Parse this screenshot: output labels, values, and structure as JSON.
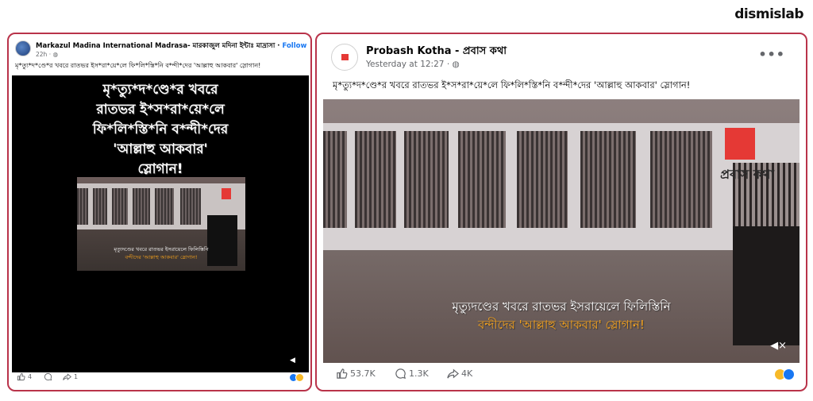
{
  "brand": "dismislab",
  "left_post": {
    "author": "Markazul Madina International Madrasa- মারকাজুল মদিনা ইন্টাঃ মাদ্রাসা",
    "follow": "Follow",
    "time": "22h",
    "caption": "মৃ*ত্যু*দ*ণ্ডে*র খবরে রাতভর ইস*রা*য়ে*লে ফি*লি*স্তি*নি ব*ন্দী*দের 'আল্লাহু আকবার' স্লোগান!",
    "overlay_lines": [
      "মৃ*ত্যু*দ*ণ্ডে*র খবরে",
      "রাতভর ই*স*রা*য়ে*লে",
      "ফি*লি*স্তি*নি ব*ন্দী*দের",
      "'আল্লাহু আকবার'",
      "স্লোগান!"
    ],
    "sub_white": "মৃত্যুদণ্ডের খবরে রাতভর ইসরায়েলে ফিলিস্তিনি",
    "sub_orange": "বন্দীদের 'আল্লাহু আকবার' স্লোগান!",
    "likes": "4",
    "shares": "1"
  },
  "right_post": {
    "author": "Probash Kotha - প্রবাস কথা",
    "time": "Yesterday at 12:27",
    "caption": "মৃ*ত্যু*দ*ণ্ডে*র খবরে রাতভর ই*স*রা*য়ে*লে ফি*লি*স্তি*নি ব*ন্দী*দের 'আল্লাহু আকবার' স্লোগান!",
    "watermark": "প্রবাস কথা",
    "sub_white": "মৃত্যুদণ্ডের খবরে রাতভর ইসরায়েলে ফিলিস্তিনি",
    "sub_orange": "বন্দীদের 'আল্লাহু আকবার' স্লোগান!",
    "reactions": "53.7K",
    "comments": "1.3K",
    "shares": "4K"
  },
  "colors": {
    "frame": "#b9334a",
    "accent": "#1877f2",
    "subtitle_orange": "#f7a31c",
    "logo_red": "#e53935"
  }
}
